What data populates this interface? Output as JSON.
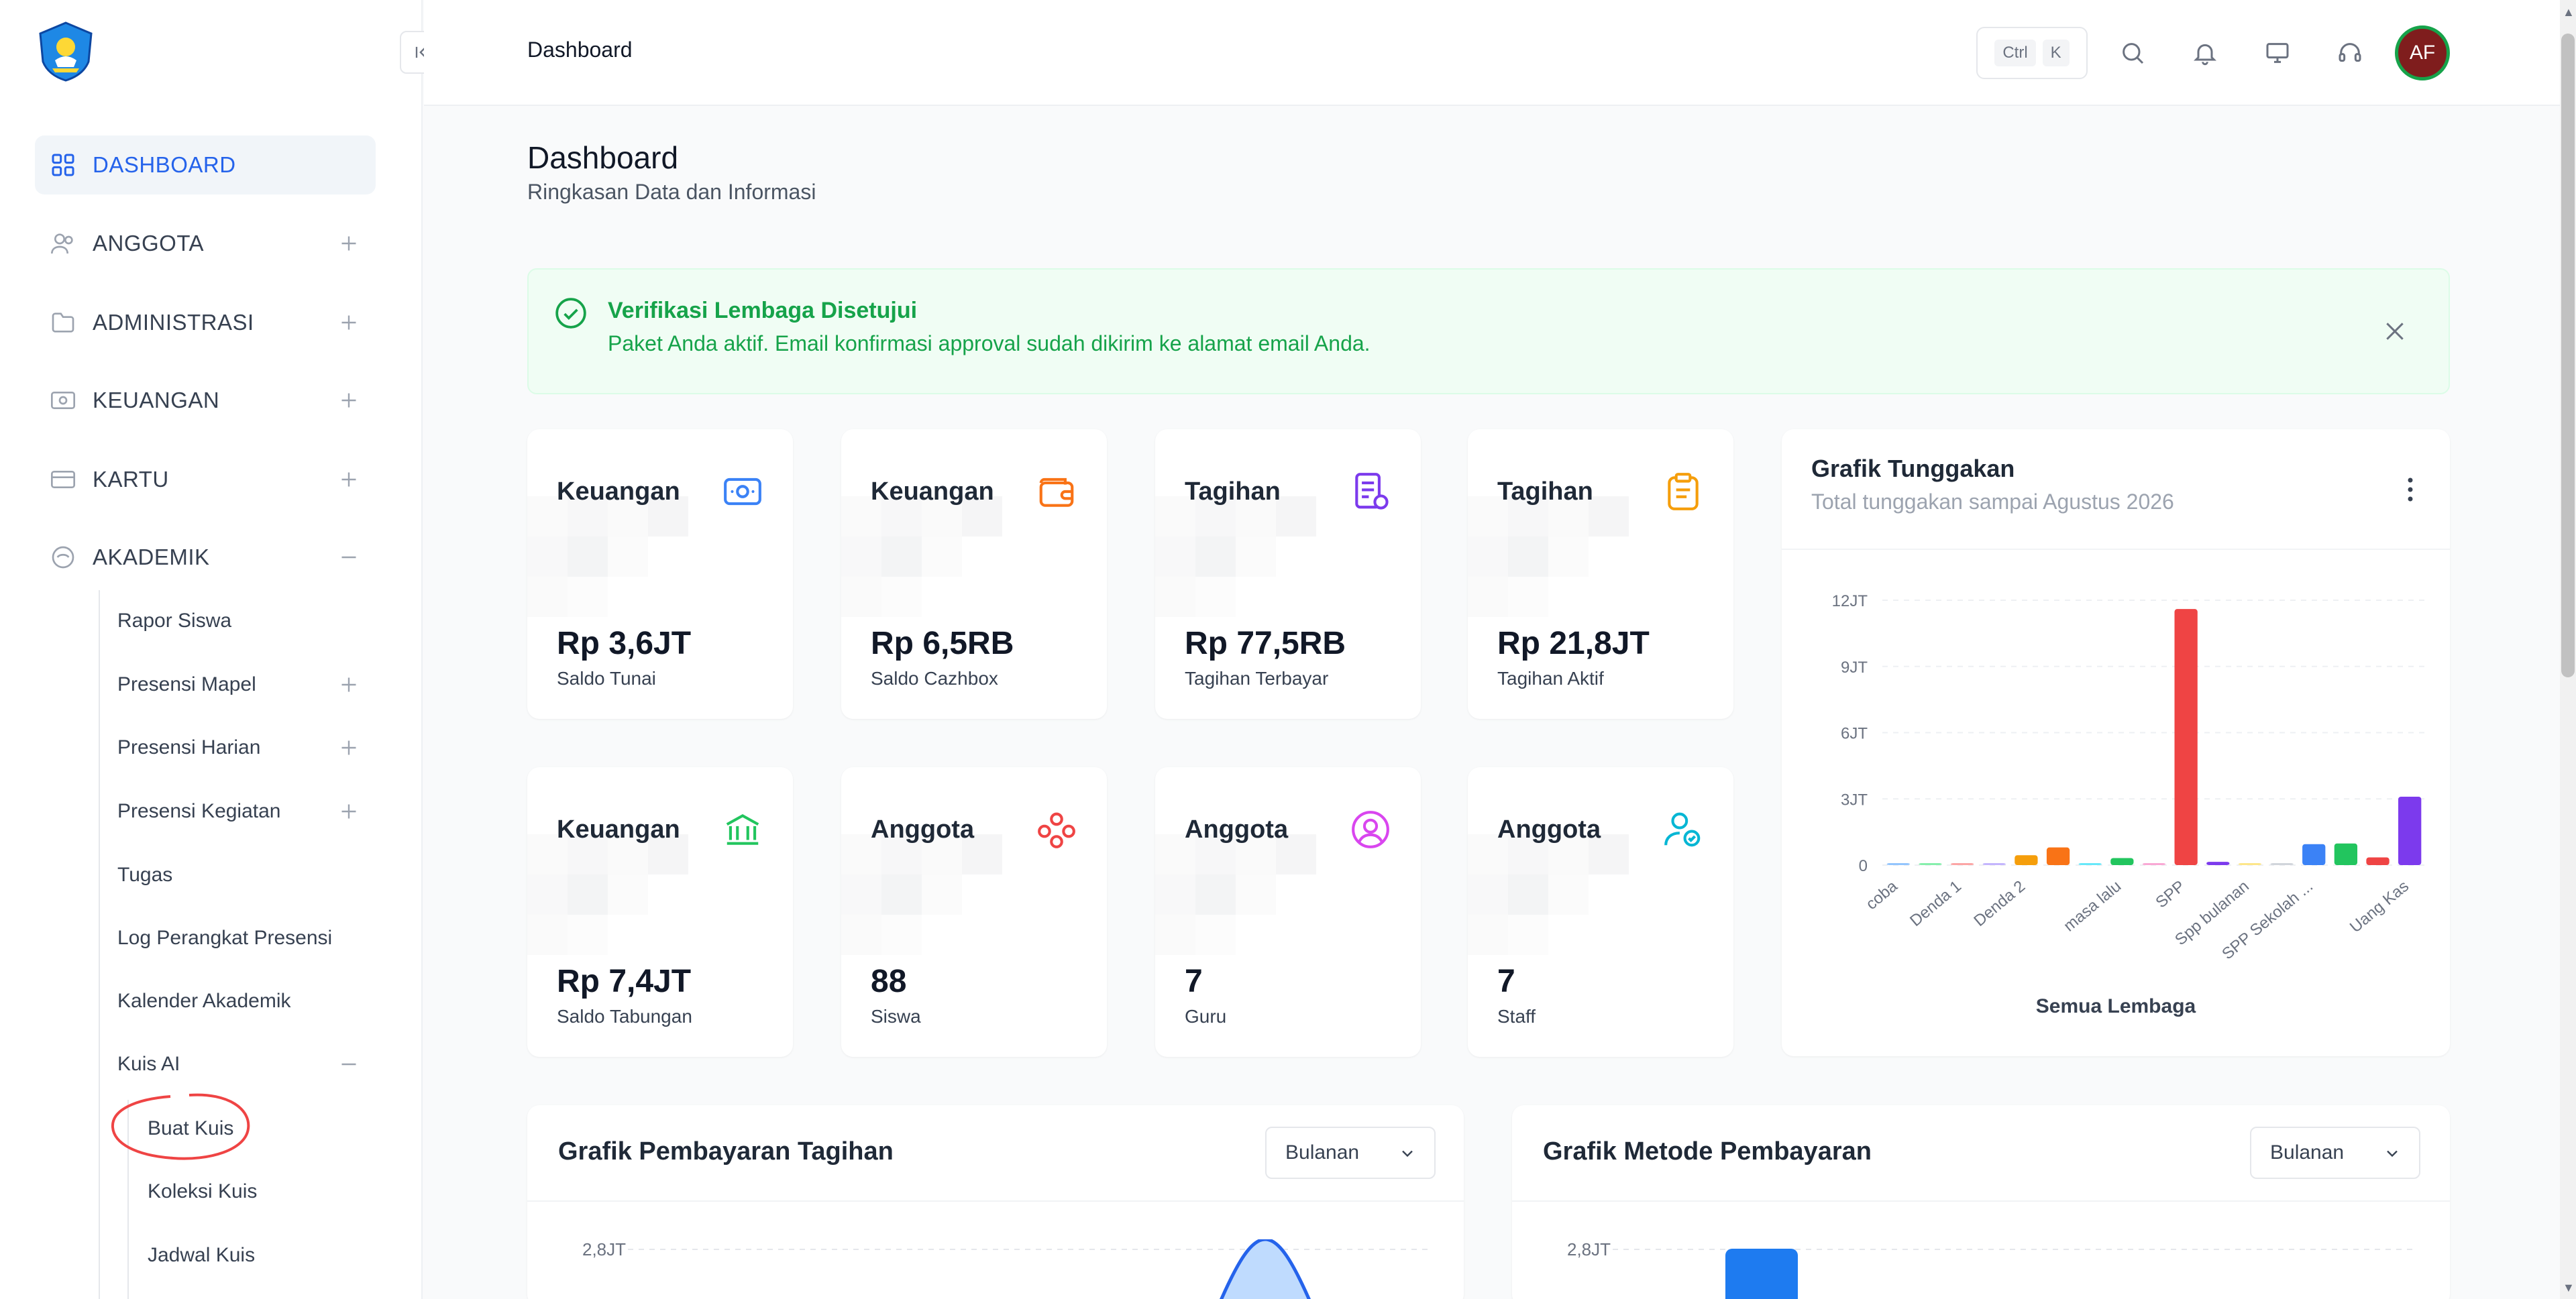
{
  "header": {
    "title": "Dashboard",
    "shortcut": [
      "Ctrl",
      "K"
    ],
    "avatar_initials": "AF"
  },
  "sidebar": {
    "items": [
      {
        "label": "DASHBOARD",
        "icon": "grid-icon",
        "active": true
      },
      {
        "label": "ANGGOTA",
        "icon": "users-icon"
      },
      {
        "label": "ADMINISTRASI",
        "icon": "folder-icon"
      },
      {
        "label": "KEUANGAN",
        "icon": "money-icon"
      },
      {
        "label": "KARTU",
        "icon": "card-icon"
      },
      {
        "label": "AKADEMIK",
        "icon": "graduation-icon",
        "expanded": true
      }
    ],
    "akademik_sub": [
      "Rapor Siswa",
      "Presensi Mapel",
      "Presensi Harian",
      "Presensi Kegiatan",
      "Tugas",
      "Log Perangkat Presensi",
      "Kalender Akademik",
      "Kuis AI"
    ],
    "kuis_sub": [
      "Buat Kuis",
      "Koleksi Kuis",
      "Jadwal Kuis"
    ]
  },
  "page": {
    "title": "Dashboard",
    "subtitle": "Ringkasan Data dan Informasi"
  },
  "alert": {
    "title": "Verifikasi Lembaga Disetujui",
    "text": "Paket Anda aktif. Email konfirmasi approval sudah dikirim ke alamat email Anda.",
    "color": "#16a34a"
  },
  "stats": [
    {
      "title": "Keuangan",
      "value": "Rp 3,6JT",
      "label": "Saldo Tunai",
      "icon": "cash-icon",
      "color": "#3b82f6"
    },
    {
      "title": "Keuangan",
      "value": "Rp 6,5RB",
      "label": "Saldo Cazhbox",
      "icon": "wallet-icon",
      "color": "#f97316"
    },
    {
      "title": "Tagihan",
      "value": "Rp 77,5RB",
      "label": "Tagihan Terbayar",
      "icon": "bill-paid-icon",
      "color": "#7c3aed"
    },
    {
      "title": "Tagihan",
      "value": "Rp 21,8JT",
      "label": "Tagihan Aktif",
      "icon": "clipboard-icon",
      "color": "#f59e0b"
    },
    {
      "title": "Keuangan",
      "value": "Rp 7,4JT",
      "label": "Saldo Tabungan",
      "icon": "bank-icon",
      "color": "#22c55e"
    },
    {
      "title": "Anggota",
      "value": "88",
      "label": "Siswa",
      "icon": "group-icon",
      "color": "#ef4444"
    },
    {
      "title": "Anggota",
      "value": "7",
      "label": "Guru",
      "icon": "user-circle-icon",
      "color": "#d946ef"
    },
    {
      "title": "Anggota",
      "value": "7",
      "label": "Staff",
      "icon": "user-check-icon",
      "color": "#06b6d4"
    }
  ],
  "tunggakan": {
    "title": "Grafik Tunggakan",
    "subtitle": "Total tunggakan sampai Agustus 2026",
    "footer": "Semua Lembaga"
  },
  "bottom": {
    "left_title": "Grafik Pembayaran Tagihan",
    "right_title": "Grafik Metode Pembayaran",
    "select_value": "Bulanan",
    "ytick": "2,8JT"
  },
  "chart_data": {
    "type": "bar",
    "title": "Grafik Tunggakan",
    "ylim": [
      0,
      12000000
    ],
    "yticks": [
      "0",
      "3JT",
      "6JT",
      "9JT",
      "12JT"
    ],
    "ytick_values": [
      0,
      3000000,
      6000000,
      9000000,
      12000000
    ],
    "categories": [
      "coba",
      "",
      "Denda 1",
      "",
      "Denda 2",
      "",
      "",
      "masa lalu",
      "",
      "SPP",
      "",
      "Spp bulanan",
      "",
      "SPP Sekolah ...",
      "",
      "",
      "Uang Kas"
    ],
    "values": [
      20000,
      30000,
      40000,
      60000,
      450000,
      800000,
      30000,
      320000,
      40000,
      11600000,
      150000,
      50000,
      10000,
      950000,
      980000,
      350000,
      3100000
    ],
    "colors": [
      "#93c5fd",
      "#86efac",
      "#fca5a5",
      "#c4b5fd",
      "#f59e0b",
      "#f97316",
      "#67e8f9",
      "#22c55e",
      "#f9a8d4",
      "#ef4444",
      "#7c3aed",
      "#fde68a",
      "#d1d5db",
      "#3b82f6",
      "#22c55e",
      "#ef4444",
      "#7c3aed"
    ],
    "grid": true,
    "legend": "none"
  }
}
